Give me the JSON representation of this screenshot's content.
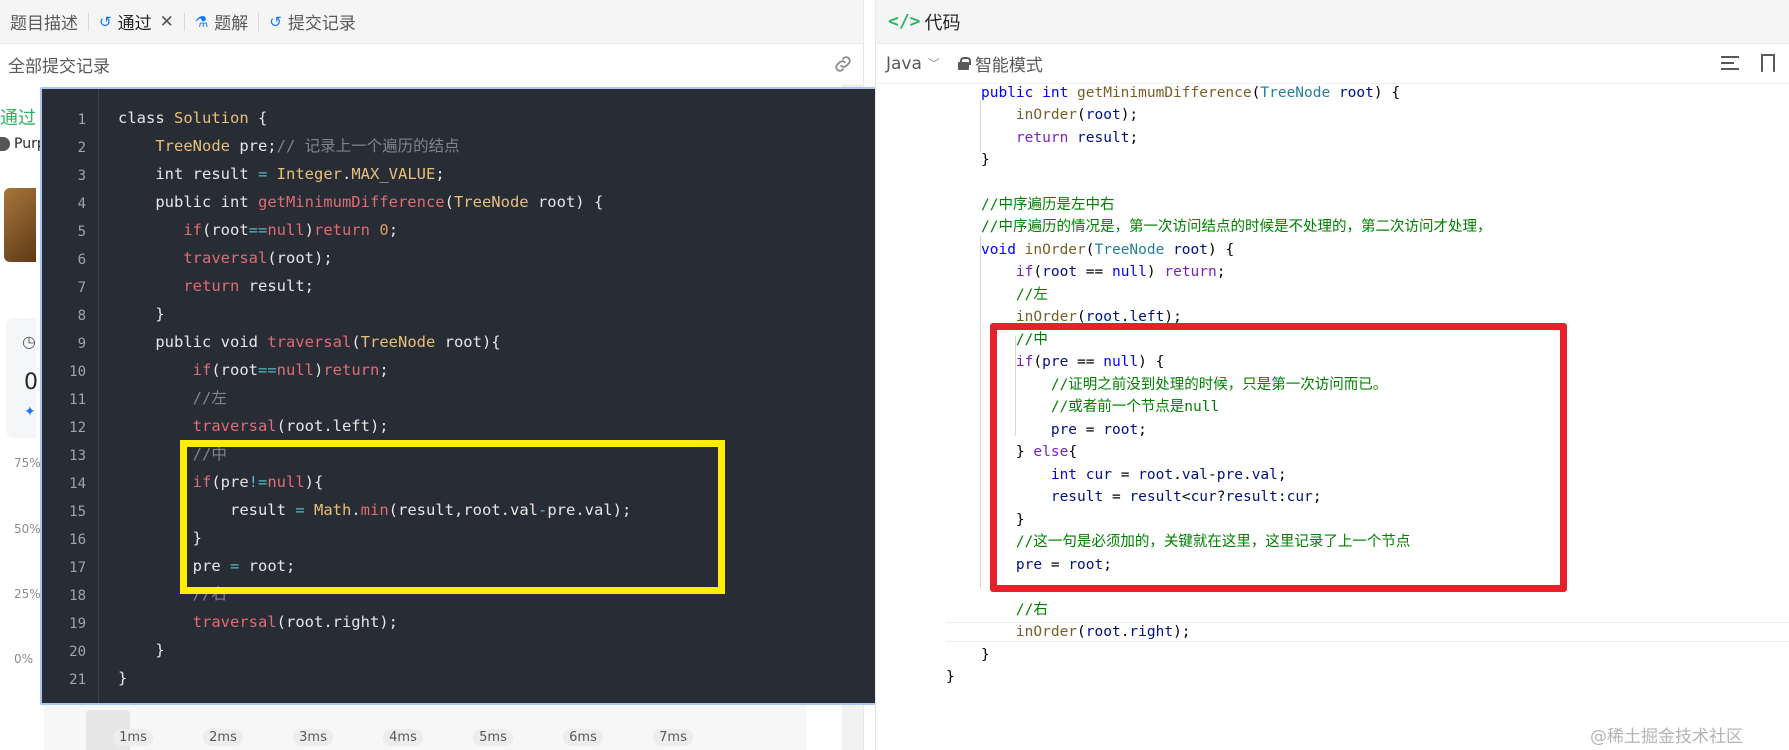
{
  "left": {
    "tabs": [
      {
        "label": "题目描述"
      },
      {
        "label": "通过"
      },
      {
        "label": "题解"
      },
      {
        "label": "提交记录"
      }
    ],
    "sub_title": "全部提交记录",
    "peek_status": "通过",
    "peek_user": "Purp",
    "peek_zero": "0",
    "pct_labels": [
      "75%",
      "50%",
      "25%",
      "0%"
    ],
    "hist_axis": [
      "1ms",
      "2ms",
      "3ms",
      "4ms",
      "5ms",
      "6ms",
      "7ms"
    ]
  },
  "popup": {
    "lang": "java",
    "line_numbers": [
      "1",
      "2",
      "3",
      "4",
      "5",
      "6",
      "7",
      "8",
      "9",
      "10",
      "11",
      "12",
      "13",
      "14",
      "15",
      "16",
      "17",
      "18",
      "19",
      "20",
      "21"
    ]
  },
  "right": {
    "title": "代码",
    "language": "Java",
    "mode": "智能模式"
  },
  "watermark": "@稀土掘金技术社区",
  "colors": {
    "highlight_yellow": "#ffee00",
    "highlight_red": "#e8202a",
    "accepted_green": "#2db55d",
    "code_bg": "#282c34"
  }
}
